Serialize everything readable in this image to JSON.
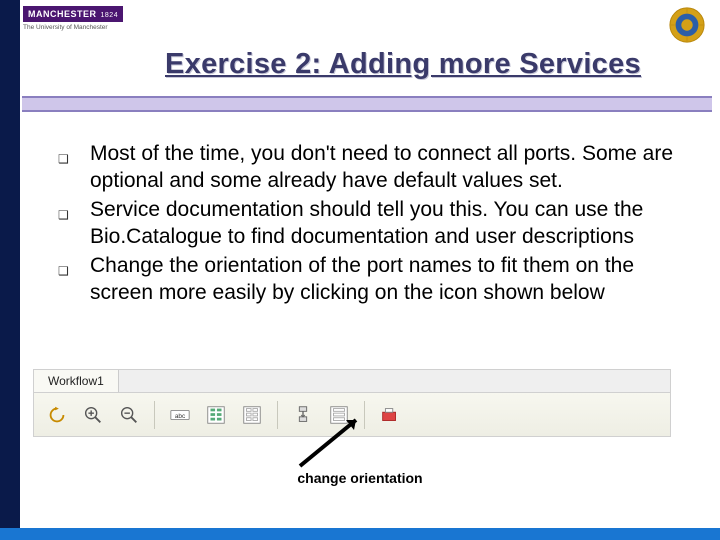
{
  "university_logo": {
    "name": "MANCHESTER",
    "year": "1824",
    "subtitle": "The University of Manchester"
  },
  "title": "Exercise 2: Adding more Services",
  "bullets": [
    "Most of the time, you don't need to connect all ports. Some are optional and some already have default values set.",
    "Service documentation should tell you this. You can use the Bio.Catalogue to find documentation and user descriptions",
    "Change the orientation of the port names to fit them on the screen more easily by clicking on the icon shown below"
  ],
  "toolbar": {
    "tab_label": "Workflow1",
    "icons": [
      "refresh-icon",
      "zoom-in-icon",
      "zoom-out-icon",
      "abc-icon",
      "all-ports-icon",
      "none-ports-icon",
      "orientation-icon",
      "blank-ports-icon",
      "collapse-icon"
    ]
  },
  "caption": "change orientation"
}
